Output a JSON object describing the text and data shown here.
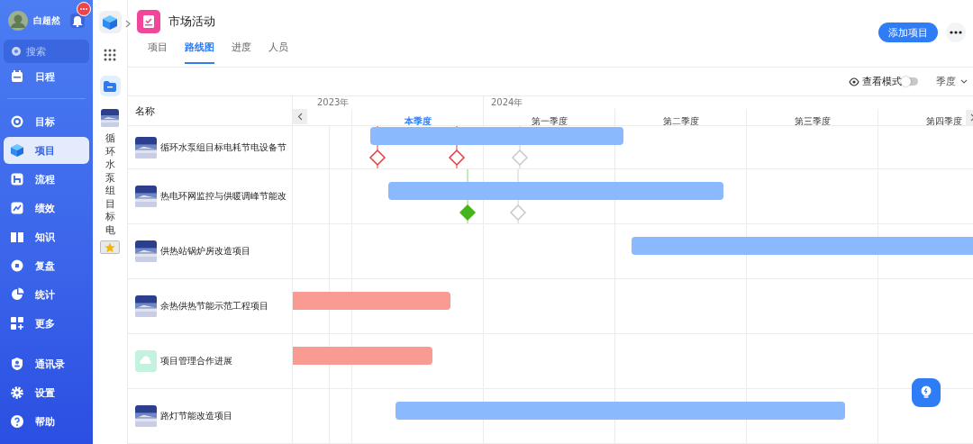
{
  "user": {
    "name": "白超然",
    "notification_badge": true
  },
  "search": {
    "placeholder": "搜索"
  },
  "nav": [
    {
      "label": "日程",
      "selected": false
    },
    {
      "label": "目标",
      "selected": false
    },
    {
      "label": "项目",
      "selected": true
    },
    {
      "label": "流程",
      "selected": false
    },
    {
      "label": "绩效",
      "selected": false
    },
    {
      "label": "知识",
      "selected": false
    },
    {
      "label": "复盘",
      "selected": false
    },
    {
      "label": "统计",
      "selected": false
    },
    {
      "label": "更多",
      "selected": false
    },
    {
      "label": "通讯录",
      "selected": false
    },
    {
      "label": "设置",
      "selected": false
    },
    {
      "label": "帮助",
      "selected": false
    }
  ],
  "rail": {
    "project_label": "循环水泵组目标电"
  },
  "header": {
    "title": "市场活动",
    "add_button": "添加项目"
  },
  "tabs": [
    {
      "label": "项目",
      "selected": false
    },
    {
      "label": "路线图",
      "selected": true
    },
    {
      "label": "进度",
      "selected": false
    },
    {
      "label": "人员",
      "selected": false
    }
  ],
  "toolbar": {
    "view_mode_label": "查看模式",
    "view_mode_on": false,
    "scale": "季度"
  },
  "table": {
    "name_header": "名称",
    "years": [
      "2023年",
      "2024年"
    ],
    "quarters": [
      {
        "label": "本季度",
        "current": true
      },
      {
        "label": "第一季度",
        "current": false
      },
      {
        "label": "第二季度",
        "current": false
      },
      {
        "label": "第三季度",
        "current": false
      },
      {
        "label": "第四季度",
        "current": false
      }
    ],
    "rows": [
      {
        "name": "循环水泵组目标电耗节电设备节",
        "kind": "picture",
        "bar": {
          "color": "#8ab9fd"
        },
        "milestones": [
          {
            "kind": "overdue"
          },
          {
            "kind": "overdue"
          },
          {
            "kind": "pending"
          }
        ]
      },
      {
        "name": "热电环网监控与供暖调峰节能改",
        "kind": "picture",
        "bar": {
          "color": "#8ab9fd"
        },
        "milestones": [
          {
            "kind": "done"
          },
          {
            "kind": "pending"
          }
        ]
      },
      {
        "name": "供热站锅炉房改造项目",
        "kind": "picture",
        "bar": {
          "color": "#8ab9fd"
        }
      },
      {
        "name": "余热供热节能示范工程项目",
        "kind": "picture",
        "bar": {
          "color": "#f99a93"
        }
      },
      {
        "name": "项目管理合作进展",
        "kind": "cloud",
        "bar": {
          "color": "#f99a93"
        }
      },
      {
        "name": "路灯节能改造项目",
        "kind": "picture",
        "bar": {
          "color": "#8ab9fd"
        }
      }
    ]
  }
}
